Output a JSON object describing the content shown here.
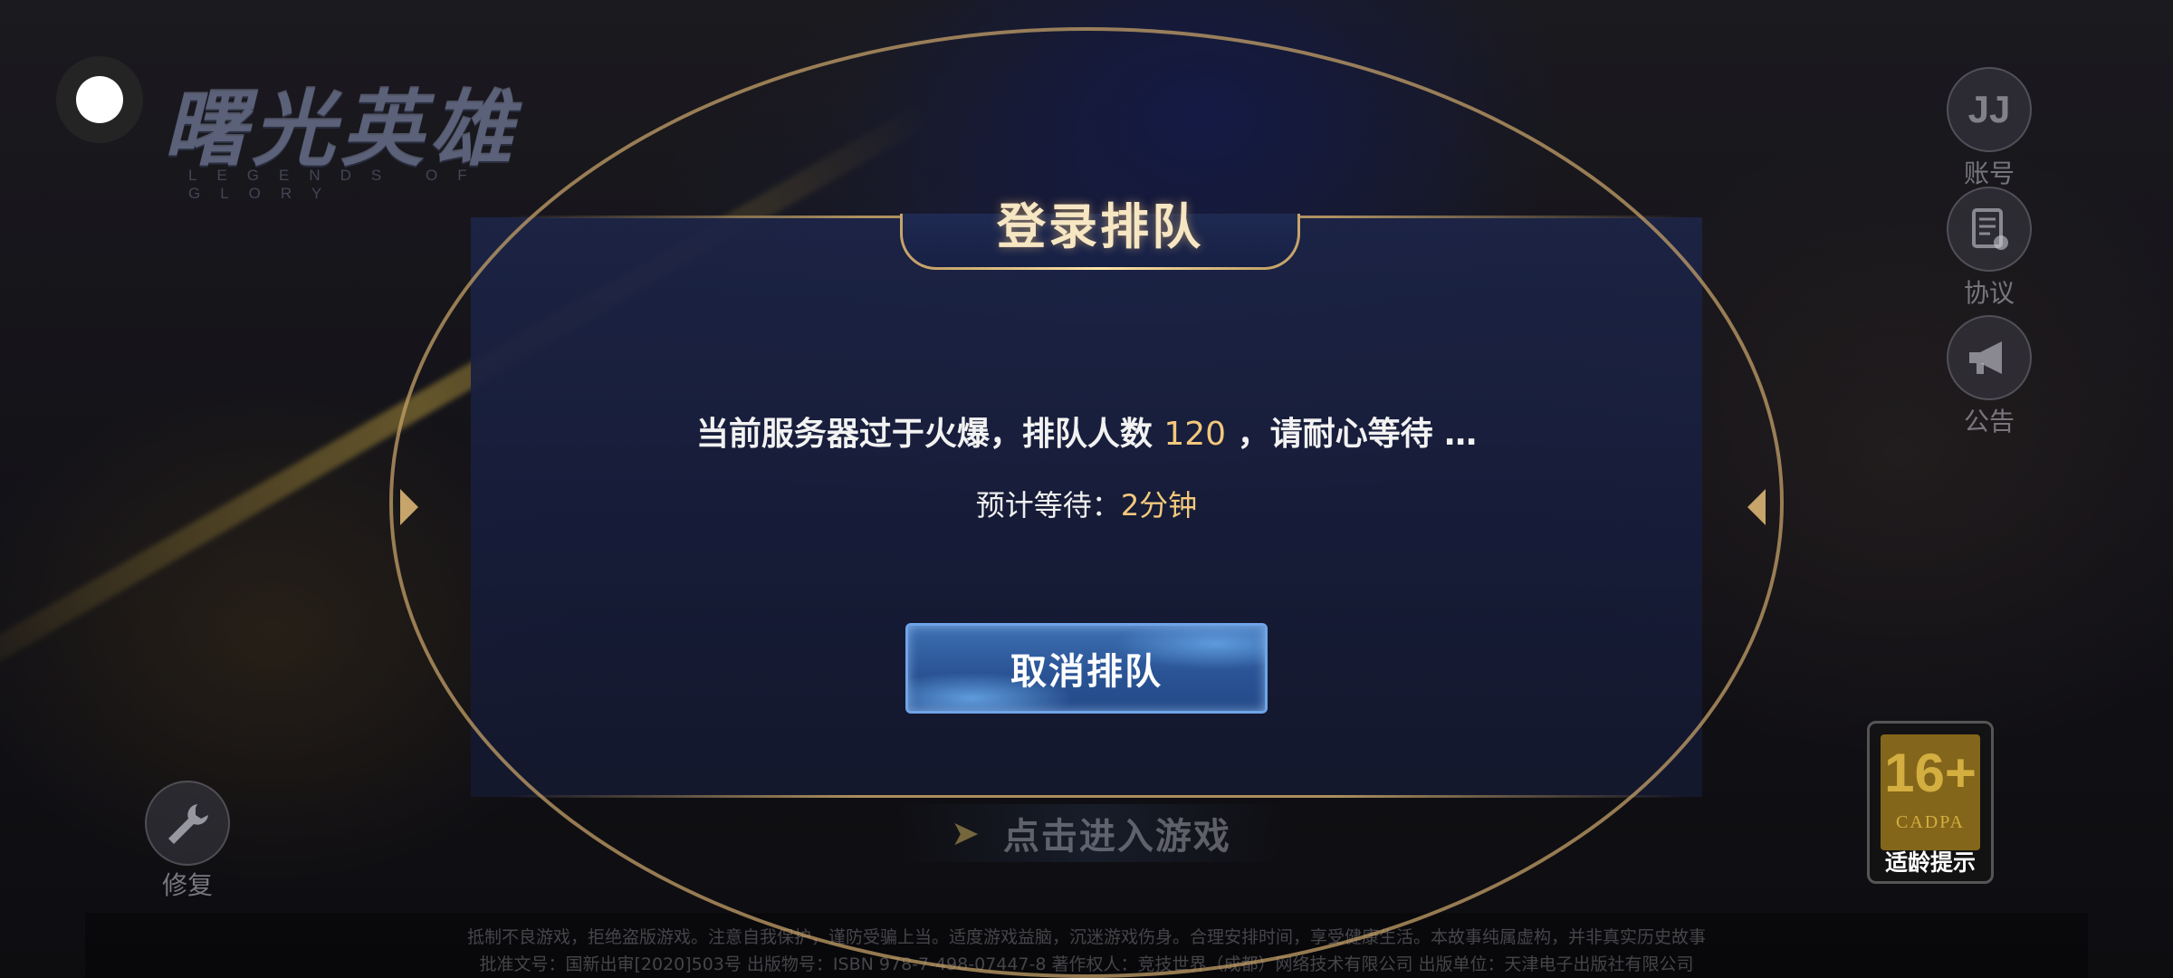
{
  "logo": {
    "title": "曙光英雄",
    "subtitle": "LEGENDS OF GLORY"
  },
  "side_buttons": [
    {
      "icon": "jj-account-icon",
      "glyph": "JJ",
      "label": "账号"
    },
    {
      "icon": "agreement-icon",
      "glyph": "▤",
      "label": "协议"
    },
    {
      "icon": "megaphone-icon",
      "glyph": "📢",
      "label": "公告"
    }
  ],
  "repair": {
    "icon": "wrench-icon",
    "label": "修复"
  },
  "age_rating": {
    "age": "16+",
    "org": "CADPA",
    "label": "适龄提示"
  },
  "modal": {
    "title": "登录排队",
    "message_prefix": "当前服务器过于火爆，排队人数 ",
    "queue_count": "120",
    "message_suffix": " ，请耐心等待 …",
    "wait_label": "预计等待：",
    "wait_value": "2分钟",
    "cancel_label": "取消排队"
  },
  "enter_game": {
    "label": "点击进入游戏"
  },
  "notice": {
    "line1": "抵制不良游戏，拒绝盗版游戏。注意自我保护，谨防受骗上当。适度游戏益脑，沉迷游戏伤身。合理安排时间，享受健康生活。本故事纯属虚构，并非真实历史故事",
    "line2": "批准文号：国新出审[2020]503号  出版物号：ISBN 978-7-498-07447-8  著作权人：竞技世界（成都）网络技术有限公司  出版单位：天津电子出版社有限公司"
  },
  "colors": {
    "accent_gold": "#f3c87c",
    "frame_gold": "#c6a46a",
    "button_blue": "#2a5496"
  }
}
